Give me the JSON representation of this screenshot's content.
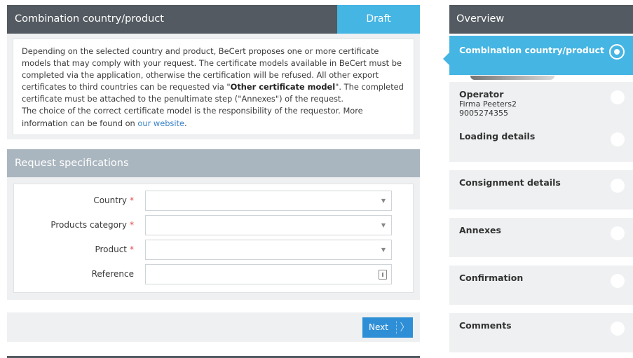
{
  "header": {
    "title": "Combination country/product",
    "status": "Draft"
  },
  "info": {
    "p1_part1": "Depending on the selected country and product, BeCert proposes one or more certificate models that may comply with your request. The certificate models available in BeCert must be completed via the application, otherwise the certification will be refused. All other export certificates to third countries can be requested via \"",
    "p1_bold": "Other certificate model",
    "p1_part2": "\". The completed certificate must be attached to the penultimate step (\"Annexes\") of the request.",
    "p2_part1": "The choice of the correct certificate model is the responsibility of the requestor. More information can be found on ",
    "p2_link": "our website",
    "p2_part2": "."
  },
  "request_spec": {
    "title": "Request specifications",
    "fields": [
      {
        "label": "Country",
        "required_mark": "*",
        "value": ""
      },
      {
        "label": "Products category",
        "required_mark": "*",
        "value": ""
      },
      {
        "label": "Product",
        "required_mark": "*",
        "value": ""
      },
      {
        "label": "Reference",
        "required_mark": "",
        "value": ""
      }
    ]
  },
  "footer": {
    "next_label": "Next",
    "next_arrow": "〉"
  },
  "overview": {
    "title": "Overview",
    "steps": [
      {
        "name": "Combination country/product",
        "active": true
      },
      {
        "name": "Operator",
        "sub1": "Firma Peeters2",
        "sub2": "9005274355"
      },
      {
        "name": "Loading details"
      },
      {
        "name": "Consignment details"
      },
      {
        "name": "Annexes"
      },
      {
        "name": "Confirmation"
      },
      {
        "name": "Comments"
      }
    ]
  },
  "colors": {
    "header_dark": "#535a61",
    "accent_blue": "#45b5e3",
    "button_blue": "#2e8fd6",
    "section_gray": "#aab6bf",
    "required_red": "#e24a4a"
  }
}
